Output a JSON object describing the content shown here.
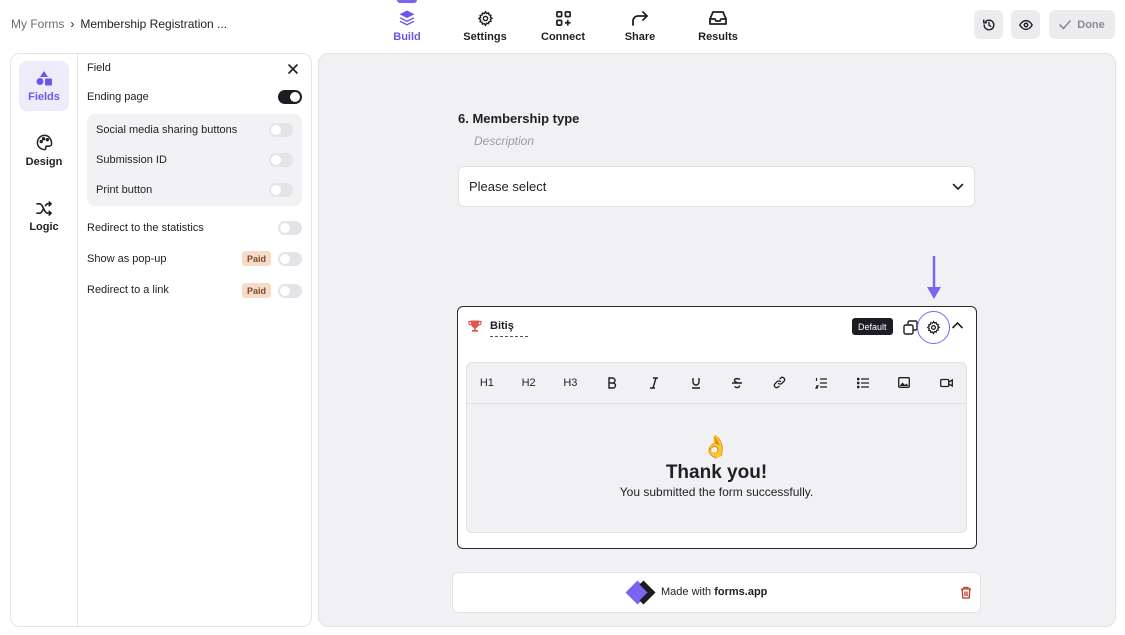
{
  "breadcrumb": {
    "root": "My Forms",
    "separator": "›",
    "current": "Membership Registration ..."
  },
  "topnav": [
    {
      "label": "Build",
      "icon": "layers-icon",
      "active": true
    },
    {
      "label": "Settings",
      "icon": "gear-icon"
    },
    {
      "label": "Connect",
      "icon": "apps-plus-icon"
    },
    {
      "label": "Share",
      "icon": "share-arrow-icon"
    },
    {
      "label": "Results",
      "icon": "inbox-icon"
    }
  ],
  "header_actions": {
    "history_icon": "history-icon",
    "preview_icon": "eye-icon",
    "done_label": "Done"
  },
  "rail": [
    {
      "label": "Fields",
      "icon": "shapes-icon",
      "active": true
    },
    {
      "label": "Design",
      "icon": "palette-icon"
    },
    {
      "label": "Logic",
      "icon": "shuffle-icon"
    }
  ],
  "field_panel": {
    "title": "Field",
    "ending_page": {
      "label": "Ending page",
      "on": true
    },
    "sub_options": [
      {
        "label": "Social media sharing buttons",
        "on": false
      },
      {
        "label": "Submission ID",
        "on": false
      },
      {
        "label": "Print button",
        "on": false
      }
    ],
    "options": [
      {
        "label": "Redirect to the statistics",
        "on": false,
        "badge": ""
      },
      {
        "label": "Show as pop-up",
        "on": false,
        "badge": "Paid"
      },
      {
        "label": "Redirect to a link",
        "on": false,
        "badge": "Paid"
      }
    ]
  },
  "question": {
    "title": "6. Membership type",
    "description": "Description",
    "select_placeholder": "Please select"
  },
  "ending_card": {
    "name": "Bitiş",
    "badge": "Default",
    "toolbar": [
      "H1",
      "H2",
      "H3",
      "bold-icon",
      "italic-icon",
      "underline-icon",
      "strikethrough-icon",
      "link-icon",
      "ordered-list-icon",
      "bullet-list-icon",
      "image-icon",
      "video-icon"
    ],
    "emoji": "👌",
    "heading": "Thank you!",
    "message": "You submitted the form successfully."
  },
  "footer": {
    "made_with": "Made with",
    "brand": "forms.app"
  },
  "colors": {
    "accent": "#7c64f0",
    "dark": "#1c1c24",
    "canvas": "#f1f1f4",
    "paid_bg": "#f6dcc8",
    "trash": "#c0392b"
  }
}
